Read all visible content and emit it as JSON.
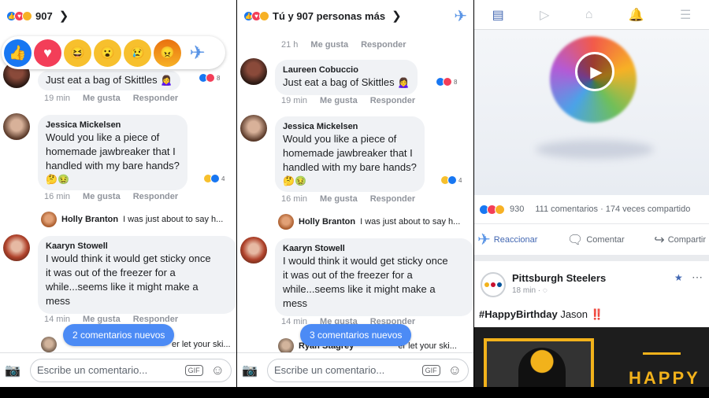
{
  "panel1": {
    "header": {
      "count": "907"
    },
    "reactions": [
      "like",
      "love",
      "haha",
      "wow",
      "sad",
      "angry",
      "plane"
    ],
    "comments": [
      {
        "author": "",
        "text": "Just eat a bag of Skittles 🙍‍♀️",
        "time": "19 min",
        "like": "Me gusta",
        "reply": "Responder",
        "count": "8"
      },
      {
        "author": "Jessica Mickelsen",
        "lines": [
          "Would you like a piece of",
          "homemade jawbreaker that I",
          "handled with my bare hands?"
        ],
        "stickers": "🤔🤢",
        "time": "16 min",
        "like": "Me gusta",
        "reply": "Responder",
        "count": "4"
      },
      {
        "author": "Kaaryn Stowell",
        "lines": [
          "I would think it would get sticky once",
          "it was out of the freezer for a",
          "while...seems like it might make a",
          "mess"
        ],
        "time": "14 min",
        "like": "Me gusta",
        "reply": "Responder"
      }
    ],
    "reply_preview": {
      "author": "Holly Branton",
      "text": "I was just about to say h..."
    },
    "reply_preview2": {
      "text": "er let your ski..."
    },
    "new_comments": "2 comentarios nuevos",
    "input_placeholder": "Escribe un comentario...",
    "gif": "GIF"
  },
  "panel2": {
    "header": {
      "text": "Tú y 907 personas más"
    },
    "top_meta": {
      "time": "21 h",
      "like": "Me gusta",
      "reply": "Responder"
    },
    "comments": [
      {
        "author": "Laureen Cobuccio",
        "text": "Just eat a bag of Skittles 🙍‍♀️",
        "time": "19 min",
        "like": "Me gusta",
        "reply": "Responder",
        "count": "8"
      },
      {
        "author": "Jessica Mickelsen",
        "lines": [
          "Would you like a piece of",
          "homemade jawbreaker that I",
          "handled with my bare hands?"
        ],
        "stickers": "🤔🤢",
        "time": "16 min",
        "like": "Me gusta",
        "reply": "Responder",
        "count": "4"
      },
      {
        "author": "Kaaryn Stowell",
        "lines": [
          "I would think it would get sticky once",
          "it was out of the freezer for a",
          "while...seems like it might make a",
          "mess"
        ],
        "time": "14 min",
        "like": "Me gusta",
        "reply": "Responder"
      }
    ],
    "reply_preview": {
      "author": "Holly Branton",
      "text": "I was just about to say h..."
    },
    "reply_preview2": {
      "author": "Ryan Stagrey",
      "text": "er let your ski..."
    },
    "new_comments": "3 comentarios nuevos",
    "input_placeholder": "Escribe un comentario...",
    "gif": "GIF"
  },
  "panel3": {
    "stats": {
      "reactions": "930",
      "comments": "111 comentarios",
      "shares": "174 veces compartido"
    },
    "actions": {
      "react": "Reaccionar",
      "comment": "Comentar",
      "share": "Compartir"
    },
    "post": {
      "page": "Pittsburgh Steelers",
      "time": "18 min · ",
      "hashtag": "#HappyBirthday",
      "name": "Jason",
      "bang": "‼️",
      "banner": "HAPPY"
    }
  },
  "colors": {
    "accent": "#4267b2",
    "pill": "#4c8bf5",
    "like": "#1877f2",
    "love": "#f33e58",
    "steelers_gold": "#f2b21b"
  }
}
